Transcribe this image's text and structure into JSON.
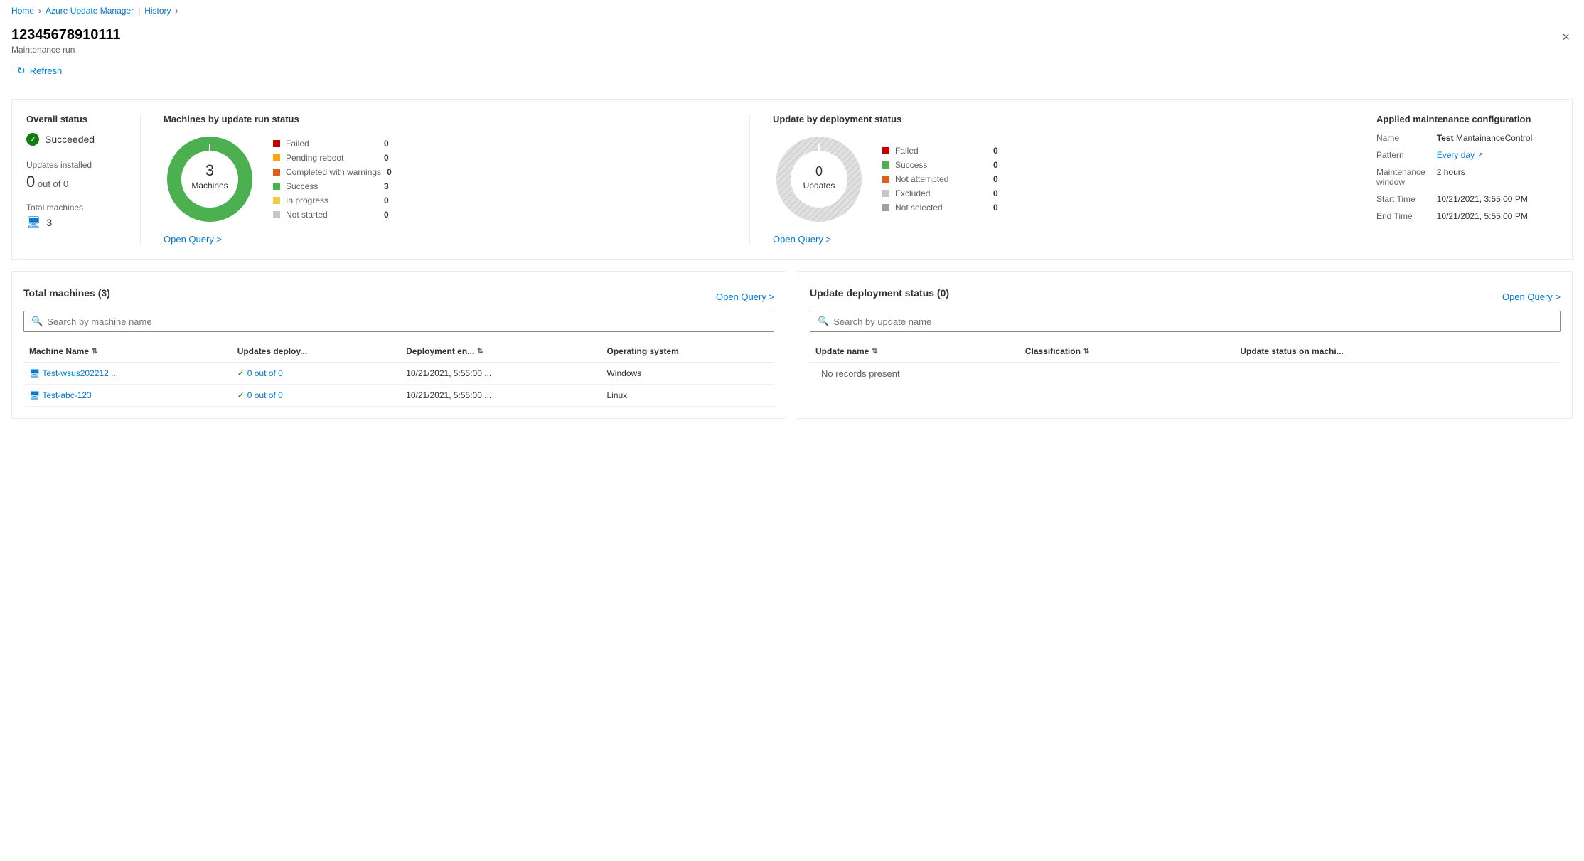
{
  "breadcrumb": {
    "home": "Home",
    "azure_update_manager": "Azure Update Manager",
    "history": "History"
  },
  "header": {
    "title": "12345678910111",
    "subtitle": "Maintenance run",
    "close_label": "×"
  },
  "toolbar": {
    "refresh_label": "Refresh"
  },
  "summary": {
    "overall_status": {
      "label": "Overall status",
      "value": "Succeeded"
    },
    "updates_installed": {
      "label": "Updates installed",
      "value": "0",
      "out_of": "out of 0"
    },
    "total_machines": {
      "label": "Total machines",
      "value": "3"
    }
  },
  "machines_chart": {
    "title": "Machines by update run status",
    "center_value": "3",
    "center_label": "Machines",
    "legend": [
      {
        "label": "Failed",
        "value": "0",
        "color": "#c40000"
      },
      {
        "label": "Pending reboot",
        "value": "0",
        "color": "#f7a711"
      },
      {
        "label": "Completed with warnings",
        "value": "0",
        "color": "#e05c1a"
      },
      {
        "label": "Success",
        "value": "3",
        "color": "#4caf50"
      },
      {
        "label": "In progress",
        "value": "0",
        "color": "#f7c948"
      },
      {
        "label": "Not started",
        "value": "0",
        "color": "#c8c6c4"
      }
    ],
    "open_query": "Open Query >"
  },
  "updates_chart": {
    "title": "Update by deployment status",
    "center_value": "0",
    "center_label": "Updates",
    "legend": [
      {
        "label": "Failed",
        "value": "0",
        "color": "#c40000"
      },
      {
        "label": "Success",
        "value": "0",
        "color": "#4caf50"
      },
      {
        "label": "Not attempted",
        "value": "0",
        "color": "#e05c1a"
      },
      {
        "label": "Excluded",
        "value": "0",
        "color": "#c8c6c4"
      },
      {
        "label": "Not selected",
        "value": "0",
        "color": "#a0a0a0"
      }
    ],
    "open_query": "Open Query >"
  },
  "maintenance_config": {
    "title": "Applied maintenance configuration",
    "name_label": "Name",
    "name_prefix": "Test",
    "name_value": "MantainanceControl",
    "pattern_label": "Pattern",
    "pattern_value": "Every day",
    "window_label": "Maintenance window",
    "window_value": "2 hours",
    "start_label": "Start Time",
    "start_value": "10/21/2021, 3:55:00 PM",
    "end_label": "End Time",
    "end_value": "10/21/2021, 5:55:00 PM"
  },
  "machines_table": {
    "title": "Total machines (3)",
    "open_query": "Open Query >",
    "search_placeholder": "Search by machine name",
    "columns": [
      "Machine Name",
      "Updates deploy...",
      "Deployment en...",
      "Operating system"
    ],
    "rows": [
      {
        "machine_name": "Test-wsus202212 ...",
        "updates": "0 out of 0",
        "deployment_end": "10/21/2021, 5:55:00 ...",
        "os": "Windows"
      },
      {
        "machine_name": "Test-abc-123",
        "updates": "0 out of 0",
        "deployment_end": "10/21/2021, 5:55:00 ...",
        "os": "Linux"
      }
    ]
  },
  "updates_table": {
    "title": "Update deployment status (0)",
    "open_query": "Open Query >",
    "search_placeholder": "Search by update name",
    "columns": [
      "Update name",
      "Classification",
      "Update status on machi..."
    ],
    "no_records": "No records present"
  }
}
